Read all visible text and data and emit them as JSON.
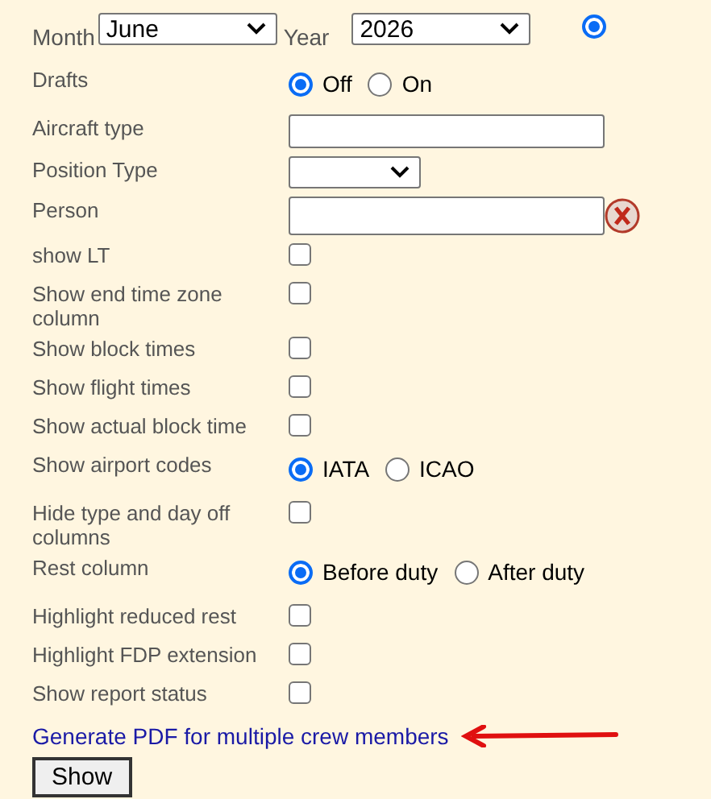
{
  "month": {
    "label": "Month",
    "value": "June"
  },
  "year": {
    "label": "Year",
    "value": "2026"
  },
  "period_radio": {
    "selected": true
  },
  "rows": [
    {
      "label": "Drafts",
      "kind": "radio",
      "options": [
        {
          "label": "Off",
          "selected": true
        },
        {
          "label": "On",
          "selected": false
        }
      ]
    },
    {
      "label": "Aircraft type",
      "kind": "text"
    },
    {
      "label": "Position Type",
      "kind": "select"
    },
    {
      "label": "Person",
      "kind": "text_clear"
    },
    {
      "label": "show LT",
      "kind": "checkbox",
      "checked": false
    },
    {
      "label": "Show end time zone column",
      "kind": "checkbox",
      "checked": false
    },
    {
      "label": "Show block times",
      "kind": "checkbox",
      "checked": false
    },
    {
      "label": "Show flight times",
      "kind": "checkbox",
      "checked": false
    },
    {
      "label": "Show actual block time",
      "kind": "checkbox",
      "checked": false
    },
    {
      "label": "Show airport codes",
      "kind": "radio",
      "options": [
        {
          "label": "IATA",
          "selected": true
        },
        {
          "label": "ICAO",
          "selected": false
        }
      ]
    },
    {
      "label": "Hide type and day off columns",
      "kind": "checkbox",
      "checked": false
    },
    {
      "label": "Rest column",
      "kind": "radio",
      "options": [
        {
          "label": "Before duty",
          "selected": true
        },
        {
          "label": "After duty",
          "selected": false
        }
      ]
    },
    {
      "label": "Highlight reduced rest",
      "kind": "checkbox",
      "checked": false
    },
    {
      "label": "Highlight FDP extension",
      "kind": "checkbox",
      "checked": false
    },
    {
      "label": "Show report status",
      "kind": "checkbox",
      "checked": false
    }
  ],
  "link": "Generate PDF for multiple crew members",
  "button": "Show"
}
